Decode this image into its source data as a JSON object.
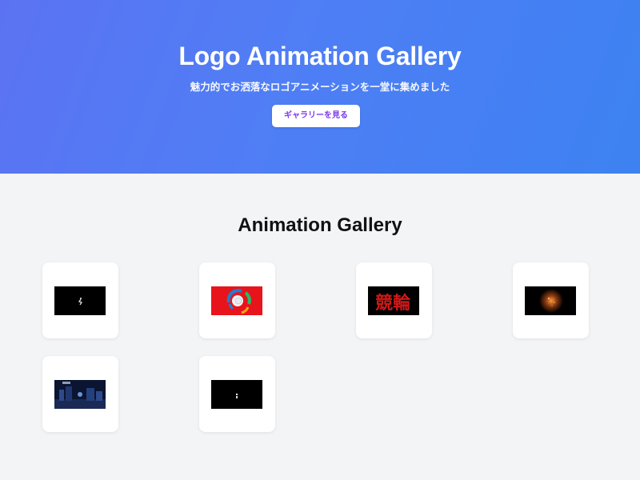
{
  "hero": {
    "title": "Logo Animation Gallery",
    "subtitle": "魅力的でお洒落なロゴアニメーションを一堂に集めました",
    "button_label": "ギャラリーを見る",
    "gradient_start": "#5b73f2",
    "gradient_end": "#3d82f2"
  },
  "gallery": {
    "title": "Animation Gallery",
    "items": [
      {
        "name": "animation-1",
        "thumbnail_kind": "dark-small-figure"
      },
      {
        "name": "animation-2",
        "thumbnail_kind": "red-swirl-circle"
      },
      {
        "name": "animation-3",
        "thumbnail_kind": "red-kanji-text"
      },
      {
        "name": "animation-4",
        "thumbnail_kind": "dark-orange-glow"
      },
      {
        "name": "animation-5",
        "thumbnail_kind": "dark-blue-scene"
      },
      {
        "name": "animation-6",
        "thumbnail_kind": "dark-small-figure"
      }
    ],
    "thumbnail_text_3": "競輪"
  },
  "colors": {
    "page_bg": "#f3f4f6",
    "button_text": "#7c3aed",
    "card_bg": "#ffffff"
  }
}
